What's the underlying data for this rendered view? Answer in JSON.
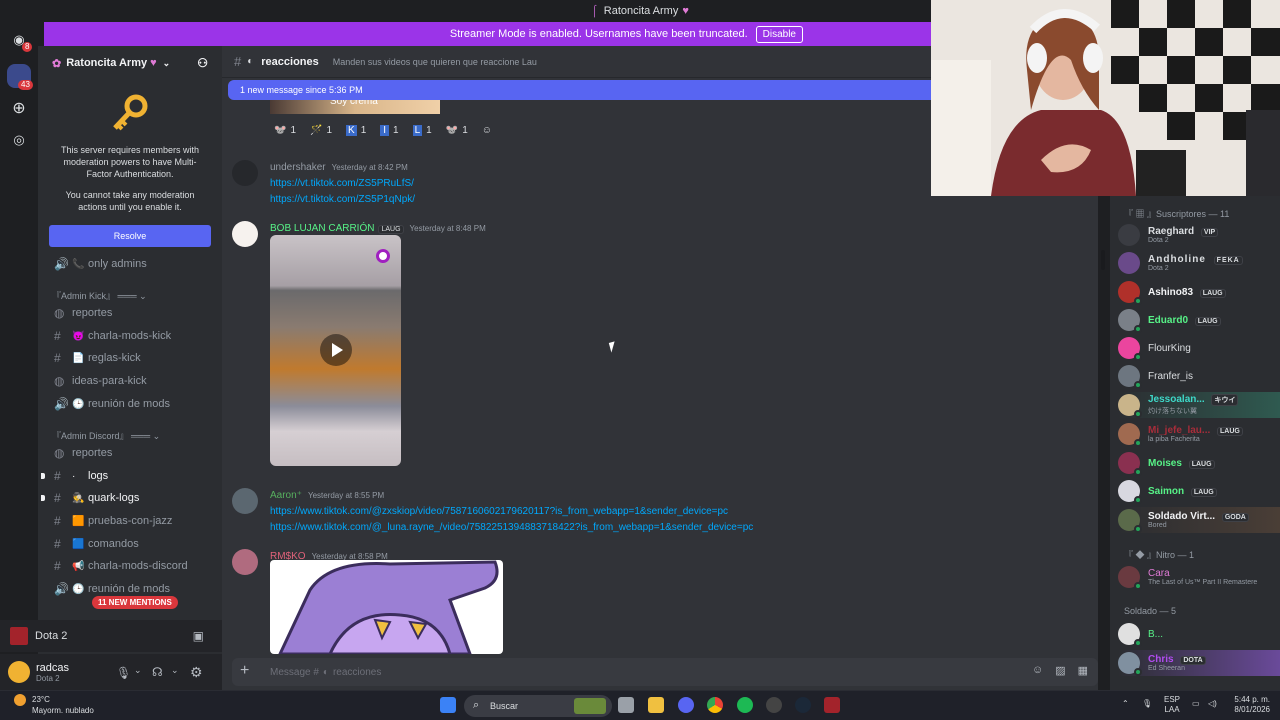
{
  "window": {
    "title": "Ratoncita Army"
  },
  "banner": {
    "text": "Streamer Mode is enabled. Usernames have been truncated.",
    "button": "Disable"
  },
  "rail": {
    "badge_top": "8",
    "badge_server": "43"
  },
  "server": {
    "name": "Ratoncita Army"
  },
  "mfa": {
    "text1": "This server requires members with moderation powers to have Multi-Factor Authentication.",
    "text2": "You cannot take any moderation actions until you enable it.",
    "button": "Resolve"
  },
  "channels": [
    {
      "label": "only admins",
      "kind": "voice",
      "emoji": "📞"
    },
    {
      "label": "reportes",
      "kind": "forum",
      "emoji": ""
    },
    {
      "label": "charla-mods-kick",
      "kind": "text",
      "emoji": "😈"
    },
    {
      "label": "reglas-kick",
      "kind": "text",
      "emoji": "📄"
    },
    {
      "label": "ideas-para-kick",
      "kind": "forum",
      "emoji": ""
    },
    {
      "label": "reunión de mods",
      "kind": "voice",
      "emoji": "🕒"
    },
    {
      "label": "reportes",
      "kind": "forum",
      "emoji": ""
    },
    {
      "label": "logs",
      "kind": "text",
      "emoji": ""
    },
    {
      "label": "quark-logs",
      "kind": "text",
      "emoji": "🕵"
    },
    {
      "label": "pruebas-con-jazz",
      "kind": "text",
      "emoji": "🟧"
    },
    {
      "label": "comandos",
      "kind": "text",
      "emoji": "🟦"
    },
    {
      "label": "charla-mods-discord",
      "kind": "text",
      "emoji": "📢"
    },
    {
      "label": "reunión de mods",
      "kind": "voice",
      "emoji": "🕒"
    }
  ],
  "categories": {
    "kick": "『Admin Kick』",
    "discord": "『Admin Discord』"
  },
  "mentions": "11 NEW MENTIONS",
  "voice": {
    "game": "Dota 2"
  },
  "user": {
    "name": "radcas",
    "status": "Dota 2"
  },
  "channel": {
    "name": "reacciones",
    "topic": "Manden sus videos que quieren que reaccione Lau"
  },
  "new_messages": "1 new message since 5:36 PM",
  "caption_fragment": "Soy crema",
  "reactions": [
    {
      "emoji": "🐭",
      "count": "1"
    },
    {
      "emoji": "🪄",
      "count": "1"
    },
    {
      "emoji": "K",
      "count": "1"
    },
    {
      "emoji": "I",
      "count": "1"
    },
    {
      "emoji": "L",
      "count": "1"
    },
    {
      "emoji": "🐭",
      "count": "1"
    }
  ],
  "messages": {
    "m1": {
      "author": "undershaker",
      "time": "Yesterday at 8:42 PM",
      "links": [
        "https://vt.tiktok.com/ZS5PRuLfS/",
        "https://vt.tiktok.com/ZS5P1qNpk/"
      ]
    },
    "m2": {
      "author": "BOB LUJAN CARRIÓN",
      "tag": "LAUG",
      "time": "Yesterday at 8:48 PM"
    },
    "m3": {
      "author": "Aaron⁺",
      "time": "Yesterday at 8:55 PM",
      "links": [
        "https://www.tiktok.com/@zxskiop/video/7587160602179620117?is_from_webapp=1&sender_device=pc",
        "https://www.tiktok.com/@_luna.rayne_/video/7582251394883718422?is_from_webapp=1&sender_device=pc"
      ]
    },
    "m4": {
      "author": "RM$KO",
      "time": "Yesterday at 8:58 PM"
    }
  },
  "composer": {
    "placeholder": "Message #",
    "channel": "reacciones"
  },
  "members": {
    "sect_subs": "Suscriptores — 11",
    "sect_nitro": "Nitro — 1",
    "sect_soldado": "Soldado — 5",
    "list": [
      {
        "name": "Raeghard",
        "tag": "VIP",
        "sub": "Dota 2",
        "color": "#dbdee1"
      },
      {
        "name": "Andholine",
        "tag": "FEKA",
        "sub": "Dota 2",
        "color": "#dbdee1"
      },
      {
        "name": "Ashino83",
        "tag": "LAUG",
        "sub": "",
        "color": "#f2f3f5"
      },
      {
        "name": "Eduard0",
        "tag": "LAUG",
        "sub": "",
        "color": "#57f287"
      },
      {
        "name": "FlourKing",
        "tag": "",
        "sub": "",
        "color": "#dbdee1"
      },
      {
        "name": "Franfer_is",
        "tag": "",
        "sub": "",
        "color": "#dbdee1"
      },
      {
        "name": "Jessoalan...",
        "tag": "キウイ",
        "sub": "灼け落ちない翼",
        "color": "#3ed9c9"
      },
      {
        "name": "Mi_jefe_lau...",
        "tag": "LAUG",
        "sub": "la piba Facherita",
        "color": "#a82d3a"
      },
      {
        "name": "Moises",
        "tag": "LAUG",
        "sub": "",
        "color": "#57f287"
      },
      {
        "name": "Saimon",
        "tag": "LAUG",
        "sub": "",
        "color": "#57f287"
      },
      {
        "name": "Soldado Virt...",
        "tag": "GODA",
        "sub": "Bored",
        "color": "#f2f3f5"
      },
      {
        "name": "Cara",
        "tag": "",
        "sub": "The Last of Us™ Part II Remastere",
        "color": "#e07bd6"
      },
      {
        "name": "B...",
        "tag": "",
        "sub": "",
        "color": "#57f287"
      },
      {
        "name": "Chris",
        "tag": "DOTA",
        "sub": "Ed Sheeran",
        "color": "#b14cf0"
      }
    ]
  },
  "taskbar": {
    "temp": "23°C",
    "weather": "Mayorm. nublado",
    "search": "Buscar",
    "lang1": "ESP",
    "lang2": "LAA",
    "time": "5:44 p. m.",
    "date": "8/01/2026"
  }
}
